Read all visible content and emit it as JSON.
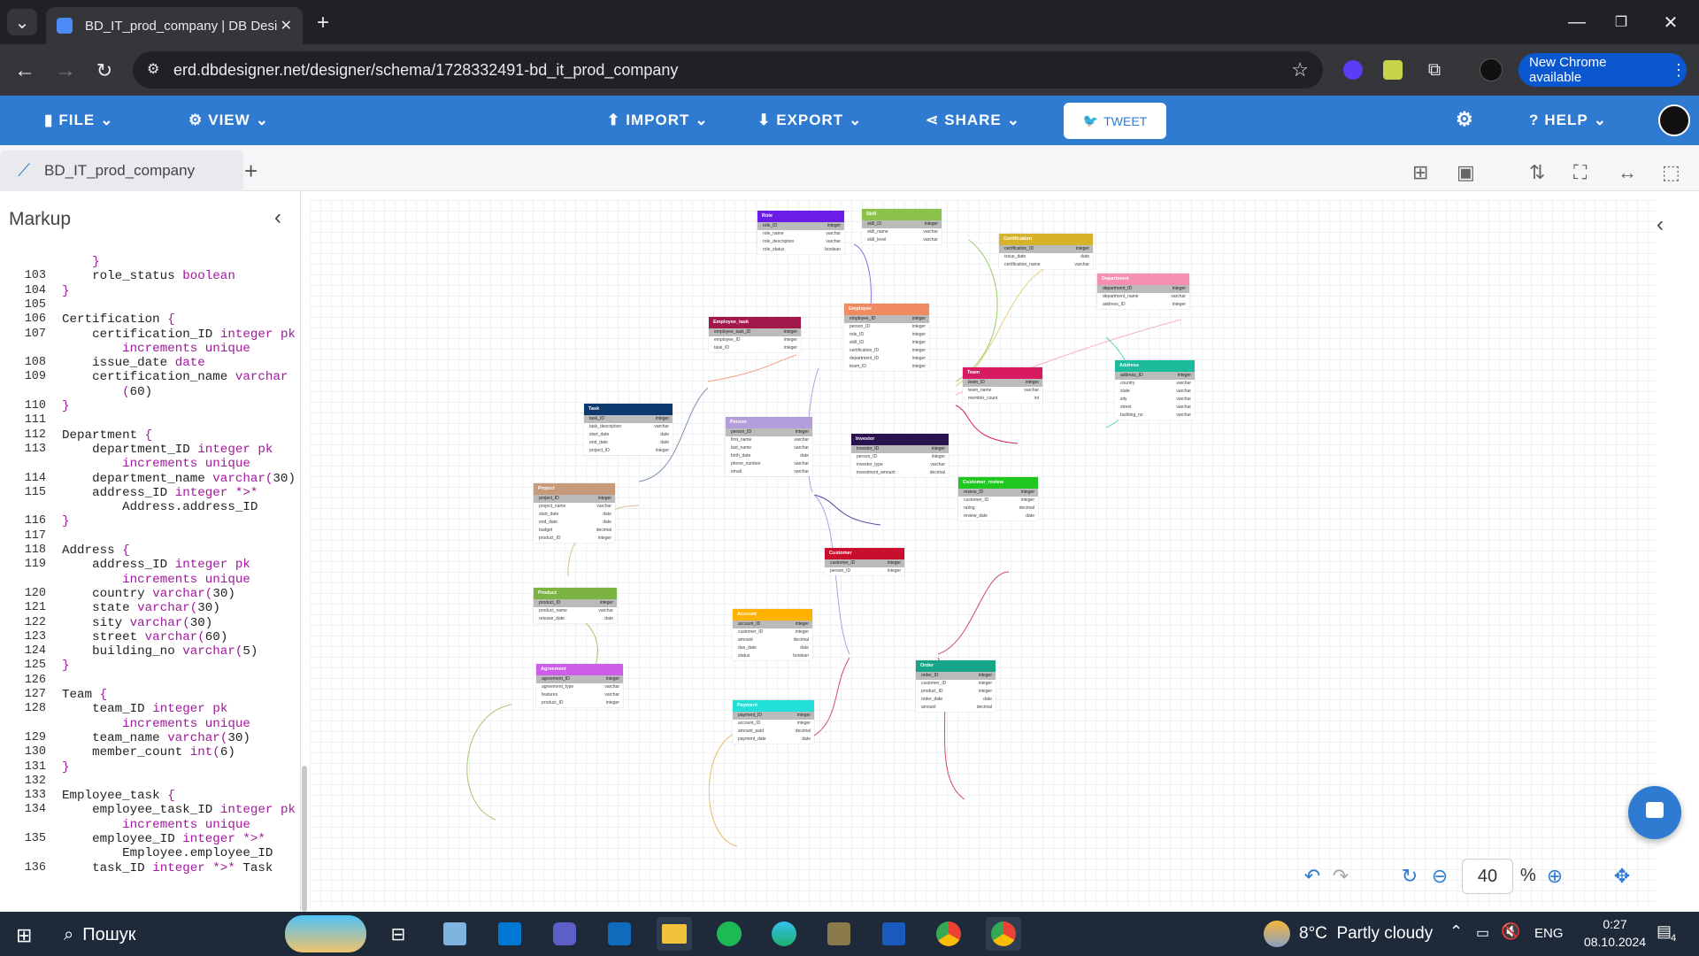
{
  "browser": {
    "tab_title": "BD_IT_prod_company | DB Desi",
    "url": "erd.dbdesigner.net/designer/schema/1728332491-bd_it_prod_company",
    "new_chrome": "New Chrome available"
  },
  "app_menu": {
    "file": "FILE",
    "view": "VIEW",
    "import": "IMPORT",
    "export": "EXPORT",
    "share": "SHARE",
    "tweet": "TWEET",
    "help": "HELP"
  },
  "doc_tab": "BD_IT_prod_company",
  "markup": {
    "title": "Markup",
    "lines": [
      {
        "n": "",
        "code": "    }"
      },
      {
        "n": "103",
        "code": "    role_status boolean"
      },
      {
        "n": "104",
        "code": "}"
      },
      {
        "n": "105",
        "code": ""
      },
      {
        "n": "106",
        "code": "Certification {"
      },
      {
        "n": "107",
        "code": "    certification_ID integer pk"
      },
      {
        "n": "",
        "code": "        increments unique"
      },
      {
        "n": "108",
        "code": "    issue_date date"
      },
      {
        "n": "109",
        "code": "    certification_name varchar"
      },
      {
        "n": "",
        "code": "        (60)"
      },
      {
        "n": "110",
        "code": "}"
      },
      {
        "n": "111",
        "code": ""
      },
      {
        "n": "112",
        "code": "Department {"
      },
      {
        "n": "113",
        "code": "    department_ID integer pk"
      },
      {
        "n": "",
        "code": "        increments unique"
      },
      {
        "n": "114",
        "code": "    department_name varchar(30)"
      },
      {
        "n": "115",
        "code": "    address_ID integer *>*"
      },
      {
        "n": "",
        "code": "        Address.address_ID"
      },
      {
        "n": "116",
        "code": "}"
      },
      {
        "n": "117",
        "code": ""
      },
      {
        "n": "118",
        "code": "Address {"
      },
      {
        "n": "119",
        "code": "    address_ID integer pk"
      },
      {
        "n": "",
        "code": "        increments unique"
      },
      {
        "n": "120",
        "code": "    country varchar(30)"
      },
      {
        "n": "121",
        "code": "    state varchar(30)"
      },
      {
        "n": "122",
        "code": "    sity varchar(30)"
      },
      {
        "n": "123",
        "code": "    street varchar(60)"
      },
      {
        "n": "124",
        "code": "    building_no varchar(5)"
      },
      {
        "n": "125",
        "code": "}"
      },
      {
        "n": "126",
        "code": ""
      },
      {
        "n": "127",
        "code": "Team {"
      },
      {
        "n": "128",
        "code": "    team_ID integer pk"
      },
      {
        "n": "",
        "code": "        increments unique"
      },
      {
        "n": "129",
        "code": "    team_name varchar(30)"
      },
      {
        "n": "130",
        "code": "    member_count int(6)"
      },
      {
        "n": "131",
        "code": "}"
      },
      {
        "n": "132",
        "code": ""
      },
      {
        "n": "133",
        "code": "Employee_task {"
      },
      {
        "n": "134",
        "code": "    employee_task_ID integer pk"
      },
      {
        "n": "",
        "code": "        increments unique"
      },
      {
        "n": "135",
        "code": "    employee_ID integer *>*"
      },
      {
        "n": "",
        "code": "        Employee.employee_ID"
      },
      {
        "n": "136",
        "code": "    task_ID integer *>* Task"
      }
    ]
  },
  "tables": [
    {
      "name": "Role",
      "color": "#6a1de6",
      "rows": [
        [
          "role_ID",
          "integer"
        ],
        [
          "role_name",
          "varchar"
        ],
        [
          "role_description",
          "varchar"
        ],
        [
          "role_status",
          "boolean"
        ]
      ]
    },
    {
      "name": "Skill",
      "color": "#8bc34a",
      "rows": [
        [
          "skill_ID",
          "integer"
        ],
        [
          "skill_name",
          "varchar"
        ],
        [
          "skill_level",
          "varchar"
        ]
      ]
    },
    {
      "name": "Certification",
      "color": "#d6b32a",
      "rows": [
        [
          "certification_ID",
          "integer"
        ],
        [
          "issue_date",
          "date"
        ],
        [
          "certification_name",
          "varchar"
        ]
      ]
    },
    {
      "name": "Department",
      "color": "#f48fb1",
      "rows": [
        [
          "department_ID",
          "integer"
        ],
        [
          "department_name",
          "varchar"
        ],
        [
          "address_ID",
          "integer"
        ]
      ]
    },
    {
      "name": "Employee",
      "color": "#f08a60",
      "rows": [
        [
          "employee_ID",
          "integer"
        ],
        [
          "person_ID",
          "integer"
        ],
        [
          "role_ID",
          "integer"
        ],
        [
          "skill_ID",
          "integer"
        ],
        [
          "certification_ID",
          "integer"
        ],
        [
          "department_ID",
          "integer"
        ],
        [
          "team_ID",
          "integer"
        ]
      ]
    },
    {
      "name": "Employee_task",
      "color": "#a3184a",
      "rows": [
        [
          "employee_task_ID",
          "integer"
        ],
        [
          "employee_ID",
          "integer"
        ],
        [
          "task_ID",
          "integer"
        ]
      ]
    },
    {
      "name": "Team",
      "color": "#d81b60",
      "rows": [
        [
          "team_ID",
          "integer"
        ],
        [
          "team_name",
          "varchar"
        ],
        [
          "member_count",
          "int"
        ]
      ]
    },
    {
      "name": "Address",
      "color": "#1abc9c",
      "rows": [
        [
          "address_ID",
          "integer"
        ],
        [
          "country",
          "varchar"
        ],
        [
          "state",
          "varchar"
        ],
        [
          "sity",
          "varchar"
        ],
        [
          "street",
          "varchar"
        ],
        [
          "building_no",
          "varchar"
        ]
      ]
    },
    {
      "name": "Task",
      "color": "#0d3a6e",
      "rows": [
        [
          "task_ID",
          "integer"
        ],
        [
          "task_description",
          "varchar"
        ],
        [
          "start_date",
          "date"
        ],
        [
          "end_date",
          "date"
        ],
        [
          "project_ID",
          "integer"
        ]
      ]
    },
    {
      "name": "Person",
      "color": "#b39ddb",
      "rows": [
        [
          "person_ID",
          "integer"
        ],
        [
          "first_name",
          "varchar"
        ],
        [
          "last_name",
          "varchar"
        ],
        [
          "birth_date",
          "date"
        ],
        [
          "phone_number",
          "varchar"
        ],
        [
          "email",
          "varchar"
        ]
      ]
    },
    {
      "name": "Investor",
      "color": "#2a1250",
      "rows": [
        [
          "investor_ID",
          "integer"
        ],
        [
          "person_ID",
          "integer"
        ],
        [
          "investor_type",
          "varchar"
        ],
        [
          "investment_amount",
          "decimal"
        ]
      ]
    },
    {
      "name": "Customer_review",
      "color": "#1ec81e",
      "rows": [
        [
          "review_ID",
          "integer"
        ],
        [
          "customer_ID",
          "integer"
        ],
        [
          "rating",
          "decimal"
        ],
        [
          "review_date",
          "date"
        ]
      ]
    },
    {
      "name": "Project",
      "color": "#c79a7a",
      "rows": [
        [
          "project_ID",
          "integer"
        ],
        [
          "project_name",
          "varchar"
        ],
        [
          "start_date",
          "date"
        ],
        [
          "end_date",
          "date"
        ],
        [
          "budget",
          "decimal"
        ],
        [
          "product_ID",
          "integer"
        ]
      ]
    },
    {
      "name": "Customer",
      "color": "#c8102e",
      "rows": [
        [
          "customer_ID",
          "integer"
        ],
        [
          "person_ID",
          "integer"
        ]
      ]
    },
    {
      "name": "Product",
      "color": "#7cb342",
      "rows": [
        [
          "product_ID",
          "integer"
        ],
        [
          "product_name",
          "varchar"
        ],
        [
          "release_date",
          "date"
        ]
      ]
    },
    {
      "name": "Account",
      "color": "#ffb300",
      "rows": [
        [
          "account_ID",
          "integer"
        ],
        [
          "customer_ID",
          "integer"
        ],
        [
          "amount",
          "decimal"
        ],
        [
          "due_date",
          "date"
        ],
        [
          "status",
          "boolean"
        ]
      ]
    },
    {
      "name": "Order",
      "color": "#17a589",
      "rows": [
        [
          "order_ID",
          "integer"
        ],
        [
          "customer_ID",
          "integer"
        ],
        [
          "product_ID",
          "integer"
        ],
        [
          "order_date",
          "date"
        ],
        [
          "amount",
          "decimal"
        ]
      ]
    },
    {
      "name": "Agreement",
      "color": "#cc5de8",
      "rows": [
        [
          "agreement_ID",
          "integer"
        ],
        [
          "agreement_type",
          "varchar"
        ],
        [
          "features",
          "varchar"
        ],
        [
          "product_ID",
          "integer"
        ]
      ]
    },
    {
      "name": "Payment",
      "color": "#22e0d8",
      "rows": [
        [
          "payment_ID",
          "integer"
        ],
        [
          "account_ID",
          "integer"
        ],
        [
          "amount_paid",
          "decimal"
        ],
        [
          "payment_date",
          "date"
        ]
      ]
    }
  ],
  "zoom": {
    "value": "40",
    "unit": "%"
  },
  "taskbar": {
    "search": "Пошук",
    "weather": "8°C  Partly cloudy",
    "lang": "ENG",
    "time": "0:27",
    "date": "08.10.2024",
    "notif": "4"
  }
}
